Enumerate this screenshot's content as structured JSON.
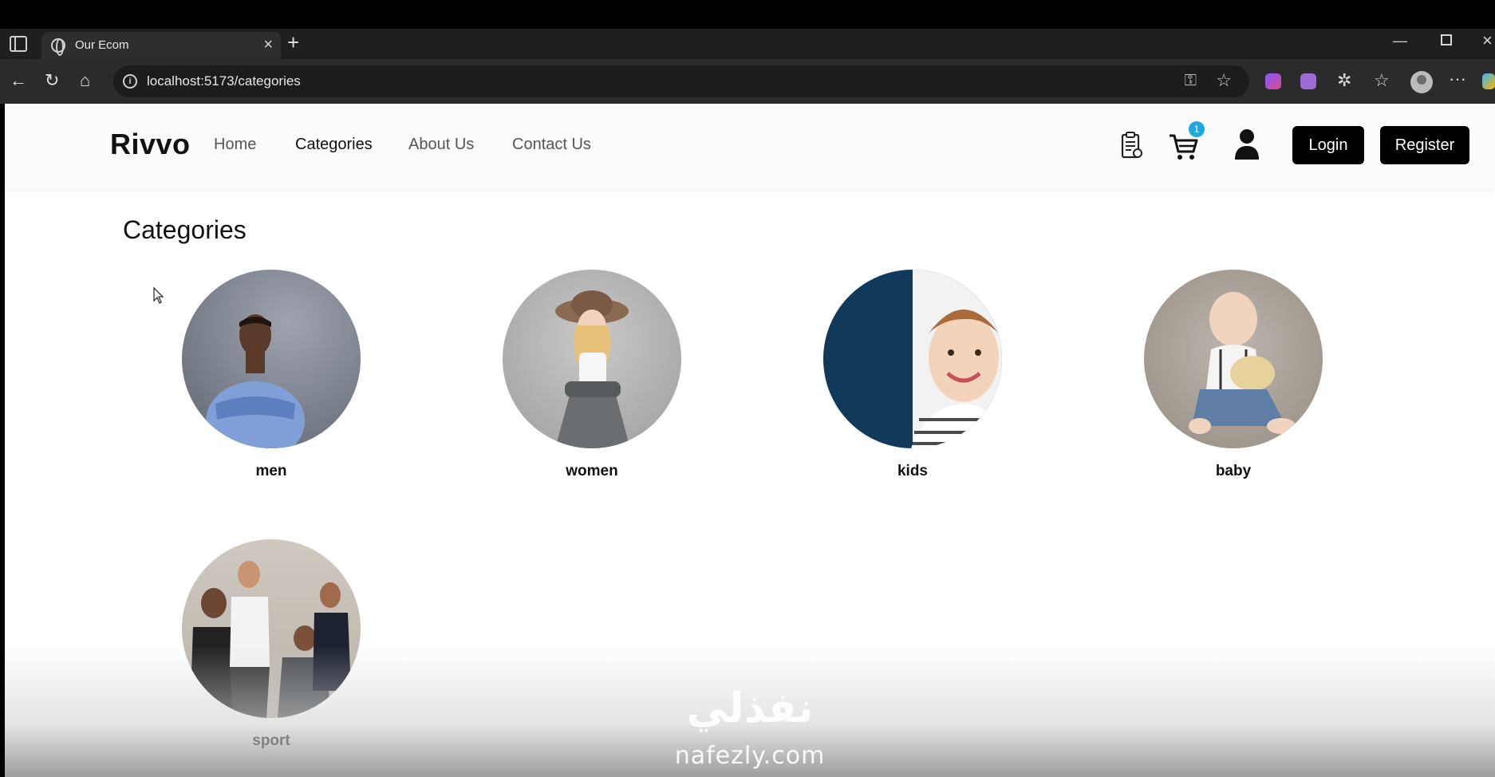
{
  "browser": {
    "tab_title": "Our Ecom",
    "url": "localhost:5173/categories"
  },
  "navbar": {
    "brand": "Rivvo",
    "links": [
      "Home",
      "Categories",
      "About Us",
      "Contact Us"
    ],
    "active_link": "Categories",
    "cart_count": "1",
    "login_label": "Login",
    "register_label": "Register"
  },
  "page": {
    "title": "Categories",
    "categories": [
      {
        "label": "men"
      },
      {
        "label": "women"
      },
      {
        "label": "kids"
      },
      {
        "label": "baby"
      },
      {
        "label": "sport"
      }
    ]
  },
  "watermark": {
    "logo_text": "نفذلي",
    "site": "nafezly.com"
  },
  "colors": {
    "button_bg": "#000000",
    "badge": "#1fa8e0",
    "navbar_bg": "#fbfbfb"
  }
}
